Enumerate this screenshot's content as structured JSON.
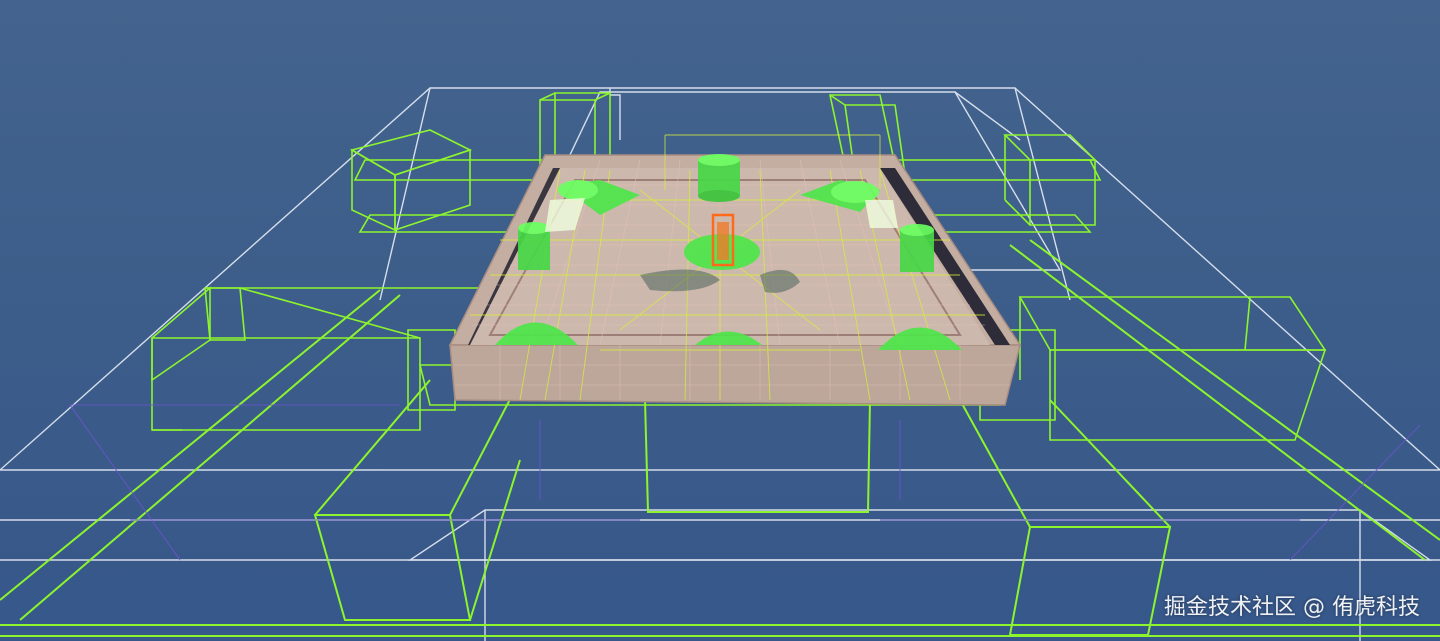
{
  "watermark": {
    "text": "掘金技术社区 @ 侑虎科技"
  },
  "colors": {
    "background": "#3f5f8c",
    "wireframe_white": "#e6ecf5",
    "bounds_green": "#8cf52c",
    "mesh_floor": "#c9b3a6",
    "mesh_grid": "#e8c0b8",
    "highlight_green": "#4ee64a",
    "selected_orange": "#ff6a1a",
    "yellow_lines": "#d8ef3a"
  }
}
